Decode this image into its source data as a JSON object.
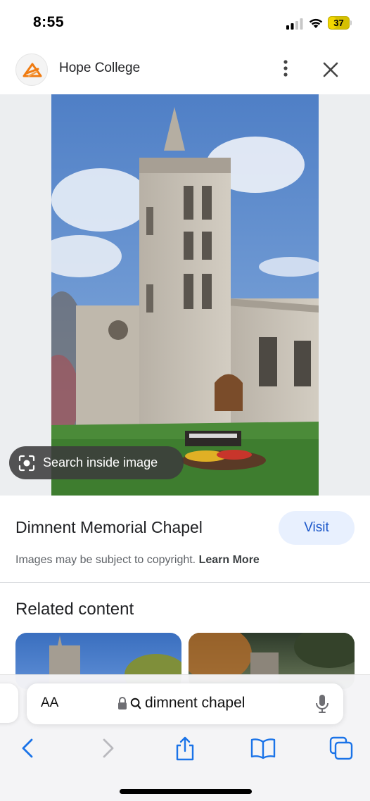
{
  "status_bar": {
    "time": "8:55",
    "battery_level": "37",
    "battery_fraction": 0.37,
    "battery_color": "#f2d600"
  },
  "header": {
    "site_name": "Hope College",
    "logo_icon": "hope-college-logo-icon",
    "more_icon": "more-vertical-icon",
    "close_icon": "close-icon"
  },
  "image_viewer": {
    "search_inside_label": "Search inside image",
    "search_inside_icon": "lens-icon"
  },
  "result": {
    "title": "Dimnent Memorial Chapel",
    "visit_label": "Visit",
    "copyright_text": "Images may be subject to copyright.",
    "learn_more_label": "Learn More"
  },
  "related": {
    "heading": "Related content"
  },
  "browser": {
    "reader_label": "AA",
    "url_text": "dimnent chapel",
    "accent_color": "#1a73e8",
    "nav_icons": [
      "back-icon",
      "forward-icon",
      "share-icon",
      "bookmarks-icon",
      "tabs-icon"
    ]
  }
}
